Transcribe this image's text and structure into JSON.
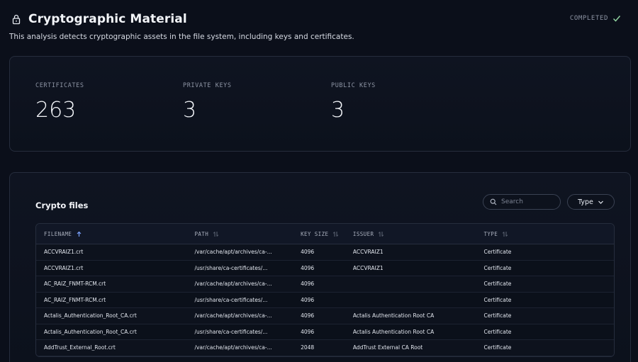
{
  "header": {
    "title": "Cryptographic Material",
    "status": "COMPLETED",
    "subtitle": "This analysis detects cryptographic assets in the file system, including keys and certificates."
  },
  "stats": [
    {
      "label": "CERTIFICATES",
      "value": "263"
    },
    {
      "label": "PRIVATE KEYS",
      "value": "3"
    },
    {
      "label": "PUBLIC KEYS",
      "value": "3"
    }
  ],
  "files": {
    "title": "Crypto files",
    "search_placeholder": "Search",
    "type_label": "Type",
    "columns": [
      "FILENAME",
      "PATH",
      "KEY SIZE",
      "ISSUER",
      "TYPE"
    ],
    "rows": [
      {
        "filename": "ACCVRAIZ1.crt",
        "path": "/var/cache/apt/archives/ca-...",
        "key_size": "4096",
        "issuer": "ACCVRAIZ1",
        "type": "Certificate"
      },
      {
        "filename": "ACCVRAIZ1.crt",
        "path": "/usr/share/ca-certificates/...",
        "key_size": "4096",
        "issuer": "ACCVRAIZ1",
        "type": "Certificate"
      },
      {
        "filename": "AC_RAIZ_FNMT-RCM.crt",
        "path": "/var/cache/apt/archives/ca-...",
        "key_size": "4096",
        "issuer": "",
        "type": "Certificate"
      },
      {
        "filename": "AC_RAIZ_FNMT-RCM.crt",
        "path": "/usr/share/ca-certificates/...",
        "key_size": "4096",
        "issuer": "",
        "type": "Certificate"
      },
      {
        "filename": "Actalis_Authentication_Root_CA.crt",
        "path": "/var/cache/apt/archives/ca-...",
        "key_size": "4096",
        "issuer": "Actalis Authentication Root CA",
        "type": "Certificate"
      },
      {
        "filename": "Actalis_Authentication_Root_CA.crt",
        "path": "/usr/share/ca-certificates/...",
        "key_size": "4096",
        "issuer": "Actalis Authentication Root CA",
        "type": "Certificate"
      },
      {
        "filename": "AddTrust_External_Root.crt",
        "path": "/var/cache/apt/archives/ca-...",
        "key_size": "2048",
        "issuer": "AddTrust External CA Root",
        "type": "Certificate"
      }
    ]
  },
  "colors": {
    "background": "#0b0f1a",
    "card_border": "#262d3d",
    "status_check": "#8fd19e",
    "sort_active": "#7aa2ff"
  }
}
